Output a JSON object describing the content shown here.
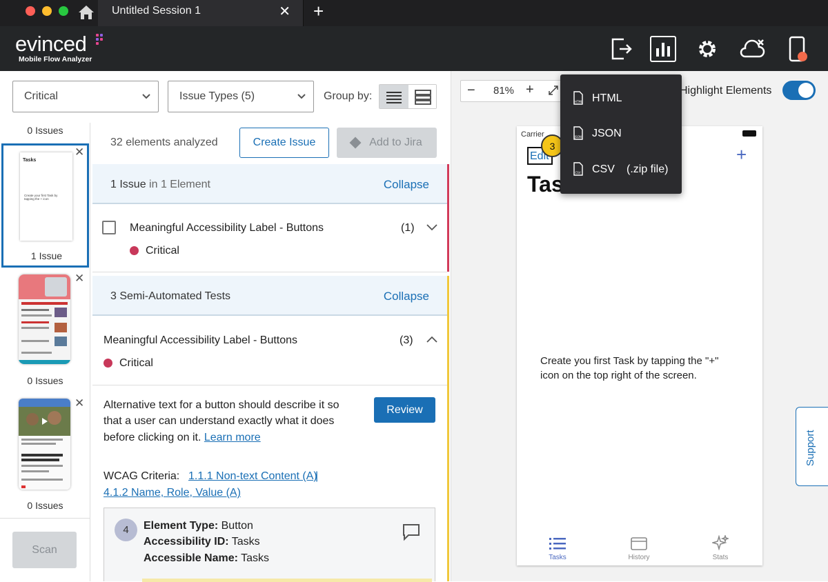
{
  "window": {
    "tab_title": "Untitled Session 1",
    "tab_close": "✕",
    "new_tab": "+"
  },
  "brand": {
    "name": "evinced",
    "subtitle": "Mobile Flow Analyzer"
  },
  "filters": {
    "severity": "Critical",
    "issue_types": "Issue Types (5)",
    "group_by_label": "Group by:"
  },
  "thumbnails": [
    {
      "label": "0 Issues"
    },
    {
      "label": "1 Issue",
      "mini_title": "Tasks",
      "mini_text": "Create your first Task by tapping the + icon"
    },
    {
      "label": "0 Issues"
    },
    {
      "label": "0 Issues"
    }
  ],
  "scan_label": "Scan",
  "toolbar": {
    "analyzed": "32 elements analyzed",
    "create_issue": "Create Issue",
    "add_to_jira": "Add to Jira"
  },
  "issues_section": {
    "count_bold": "1 Issue",
    "count_rest": " in 1 Element",
    "collapse": "Collapse",
    "item_title": "Meaningful Accessibility Label - Buttons",
    "item_count": "(1)",
    "severity": "Critical"
  },
  "semi_section": {
    "title": "3 Semi-Automated Tests",
    "collapse": "Collapse",
    "item_title": "Meaningful Accessibility Label - Buttons",
    "item_count": "(3)",
    "severity": "Critical",
    "description_1": "Alternative text for a button should describe it so",
    "description_2": "that a user can understand exactly what it does",
    "description_3": "before clicking on it.",
    "learn_more": "Learn more",
    "review": "Review",
    "wcag_label": "WCAG Criteria:",
    "wcag_1": "1.1.1 Non-text Content (A)",
    "wcag_sep": "|",
    "wcag_2": "4.1.2 Name, Role, Value (A)"
  },
  "element_card": {
    "number": "4",
    "type_label": "Element Type:",
    "type_value": " Button",
    "id_label": "Accessibility ID:",
    "id_value": " Tasks",
    "name_label": "Accessible Name:",
    "name_value": " Tasks"
  },
  "preview": {
    "zoom": "81%",
    "zoom_minus": "−",
    "zoom_plus": "+",
    "highlight_label": "Highlight Elements",
    "highlight_on": true,
    "carrier": "Carrier",
    "edit": "Edit",
    "badge": "3",
    "add": "+",
    "screen_title": "Tasks",
    "empty_1": "Create you first Task by tapping the \"+\"",
    "empty_2": "icon on the top right of the screen.",
    "tabs": [
      {
        "label": "Tasks",
        "active": true
      },
      {
        "label": "History",
        "active": false
      },
      {
        "label": "Stats",
        "active": false
      }
    ],
    "support": "Support"
  },
  "export_menu": {
    "items": [
      {
        "label": "HTML",
        "icon_text": "HTML"
      },
      {
        "label": "JSON",
        "icon_text": "JSON"
      },
      {
        "label": "CSV",
        "icon_text": "CSV",
        "note": "(.zip file)"
      }
    ]
  },
  "colors": {
    "accent": "#1a6fb5",
    "critical": "#c8385a",
    "badge": "#f5c518"
  }
}
